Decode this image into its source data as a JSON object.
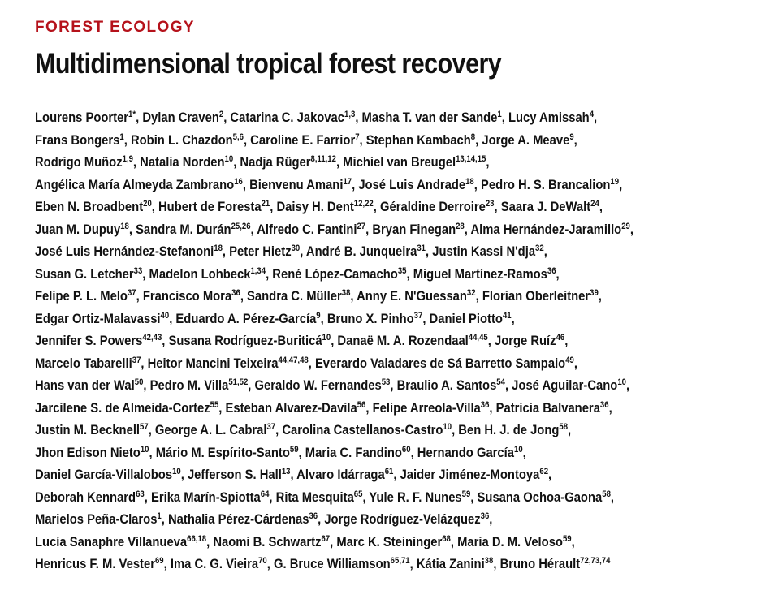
{
  "section": "FOREST ECOLOGY",
  "title": "Multidimensional tropical forest recovery",
  "author_lines": [
    [
      [
        "Lourens Poorter",
        "1*",
        ", "
      ],
      [
        "Dylan Craven",
        "2",
        ", "
      ],
      [
        "Catarina C. Jakovac",
        "1,3",
        ", "
      ],
      [
        "Masha T. van der Sande",
        "1",
        ", "
      ],
      [
        "Lucy Amissah",
        "4",
        ","
      ]
    ],
    [
      [
        "Frans Bongers",
        "1",
        ", "
      ],
      [
        "Robin L. Chazdon",
        "5,6",
        ", "
      ],
      [
        "Caroline E. Farrior",
        "7",
        ", "
      ],
      [
        "Stephan Kambach",
        "8",
        ", "
      ],
      [
        "Jorge A. Meave",
        "9",
        ","
      ]
    ],
    [
      [
        "Rodrigo Muñoz",
        "1,9",
        ", "
      ],
      [
        "Natalia Norden",
        "10",
        ", "
      ],
      [
        "Nadja Rüger",
        "8,11,12",
        ", "
      ],
      [
        "Michiel van Breugel",
        "13,14,15",
        ","
      ]
    ],
    [
      [
        "Angélica María Almeyda Zambrano",
        "16",
        ", "
      ],
      [
        "Bienvenu Amani",
        "17",
        ", "
      ],
      [
        "José Luis Andrade",
        "18",
        ", "
      ],
      [
        "Pedro H. S. Brancalion",
        "19",
        ","
      ]
    ],
    [
      [
        "Eben N. Broadbent",
        "20",
        ", "
      ],
      [
        "Hubert de Foresta",
        "21",
        ", "
      ],
      [
        "Daisy H. Dent",
        "12,22",
        ", "
      ],
      [
        "Géraldine Derroire",
        "23",
        ", "
      ],
      [
        "Saara J. DeWalt",
        "24",
        ","
      ]
    ],
    [
      [
        "Juan M. Dupuy",
        "18",
        ", "
      ],
      [
        "Sandra M. Durán",
        "25,26",
        ", "
      ],
      [
        "Alfredo C. Fantini",
        "27",
        ", "
      ],
      [
        "Bryan Finegan",
        "28",
        ", "
      ],
      [
        "Alma Hernández-Jaramillo",
        "29",
        ","
      ]
    ],
    [
      [
        "José Luis Hernández-Stefanoni",
        "18",
        ", "
      ],
      [
        "Peter Hietz",
        "30",
        ", "
      ],
      [
        "André B. Junqueira",
        "31",
        ", "
      ],
      [
        "Justin Kassi N'dja",
        "32",
        ","
      ]
    ],
    [
      [
        "Susan G. Letcher",
        "33",
        ", "
      ],
      [
        "Madelon Lohbeck",
        "1,34",
        ", "
      ],
      [
        "René López-Camacho",
        "35",
        ", "
      ],
      [
        "Miguel Martínez-Ramos",
        "36",
        ","
      ]
    ],
    [
      [
        "Felipe P. L. Melo",
        "37",
        ", "
      ],
      [
        "Francisco Mora",
        "36",
        ", "
      ],
      [
        "Sandra C. Müller",
        "38",
        ", "
      ],
      [
        "Anny E. N'Guessan",
        "32",
        ", "
      ],
      [
        "Florian Oberleitner",
        "39",
        ","
      ]
    ],
    [
      [
        "Edgar Ortiz-Malavassi",
        "40",
        ", "
      ],
      [
        "Eduardo A. Pérez-García",
        "9",
        ", "
      ],
      [
        "Bruno X. Pinho",
        "37",
        ", "
      ],
      [
        "Daniel Piotto",
        "41",
        ","
      ]
    ],
    [
      [
        "Jennifer S. Powers",
        "42,43",
        ", "
      ],
      [
        "Susana Rodríguez-Buriticá",
        "10",
        ", "
      ],
      [
        "Danaë M. A. Rozendaal",
        "44,45",
        ", "
      ],
      [
        "Jorge Ruíz",
        "46",
        ","
      ]
    ],
    [
      [
        "Marcelo Tabarelli",
        "37",
        ", "
      ],
      [
        "Heitor Mancini Teixeira",
        "44,47,48",
        ", "
      ],
      [
        "Everardo Valadares de Sá Barretto Sampaio",
        "49",
        ","
      ]
    ],
    [
      [
        "Hans van der Wal",
        "50",
        ", "
      ],
      [
        "Pedro M. Villa",
        "51,52",
        ", "
      ],
      [
        "Geraldo W. Fernandes",
        "53",
        ", "
      ],
      [
        "Braulio A. Santos",
        "54",
        ", "
      ],
      [
        "José Aguilar-Cano",
        "10",
        ","
      ]
    ],
    [
      [
        "Jarcilene S. de Almeida-Cortez",
        "55",
        ", "
      ],
      [
        "Esteban Alvarez-Davila",
        "56",
        ", "
      ],
      [
        "Felipe Arreola-Villa",
        "36",
        ", "
      ],
      [
        "Patricia Balvanera",
        "36",
        ","
      ]
    ],
    [
      [
        "Justin M. Becknell",
        "57",
        ", "
      ],
      [
        "George A. L. Cabral",
        "37",
        ", "
      ],
      [
        "Carolina Castellanos-Castro",
        "10",
        ", "
      ],
      [
        "Ben H. J. de Jong",
        "58",
        ","
      ]
    ],
    [
      [
        "Jhon Edison Nieto",
        "10",
        ", "
      ],
      [
        "Mário M. Espírito-Santo",
        "59",
        ", "
      ],
      [
        "Maria C. Fandino",
        "60",
        ", "
      ],
      [
        "Hernando García",
        "10",
        ","
      ]
    ],
    [
      [
        "Daniel García-Villalobos",
        "10",
        ", "
      ],
      [
        "Jefferson S. Hall",
        "13",
        ", "
      ],
      [
        "Alvaro Idárraga",
        "61",
        ", "
      ],
      [
        "Jaider Jiménez-Montoya",
        "62",
        ","
      ]
    ],
    [
      [
        "Deborah Kennard",
        "63",
        ", "
      ],
      [
        "Erika Marín-Spiotta",
        "64",
        ", "
      ],
      [
        "Rita Mesquita",
        "65",
        ", "
      ],
      [
        "Yule R. F. Nunes",
        "59",
        ", "
      ],
      [
        "Susana Ochoa-Gaona",
        "58",
        ","
      ]
    ],
    [
      [
        "Marielos Peña-Claros",
        "1",
        ", "
      ],
      [
        "Nathalia Pérez-Cárdenas",
        "36",
        ", "
      ],
      [
        "Jorge Rodríguez-Velázquez",
        "36",
        ","
      ]
    ],
    [
      [
        "Lucía Sanaphre Villanueva",
        "66,18",
        ", "
      ],
      [
        "Naomi B. Schwartz",
        "67",
        ", "
      ],
      [
        "Marc K. Steininger",
        "68",
        ", "
      ],
      [
        "Maria D. M. Veloso",
        "59",
        ","
      ]
    ],
    [
      [
        "Henricus F. M. Vester",
        "69",
        ", "
      ],
      [
        "Ima C. G. Vieira",
        "70",
        ", "
      ],
      [
        "G. Bruce Williamson",
        "65,71",
        ", "
      ],
      [
        "Kátia Zanini",
        "38",
        ", "
      ],
      [
        "Bruno Hérault",
        "72,73,74",
        ""
      ]
    ]
  ]
}
